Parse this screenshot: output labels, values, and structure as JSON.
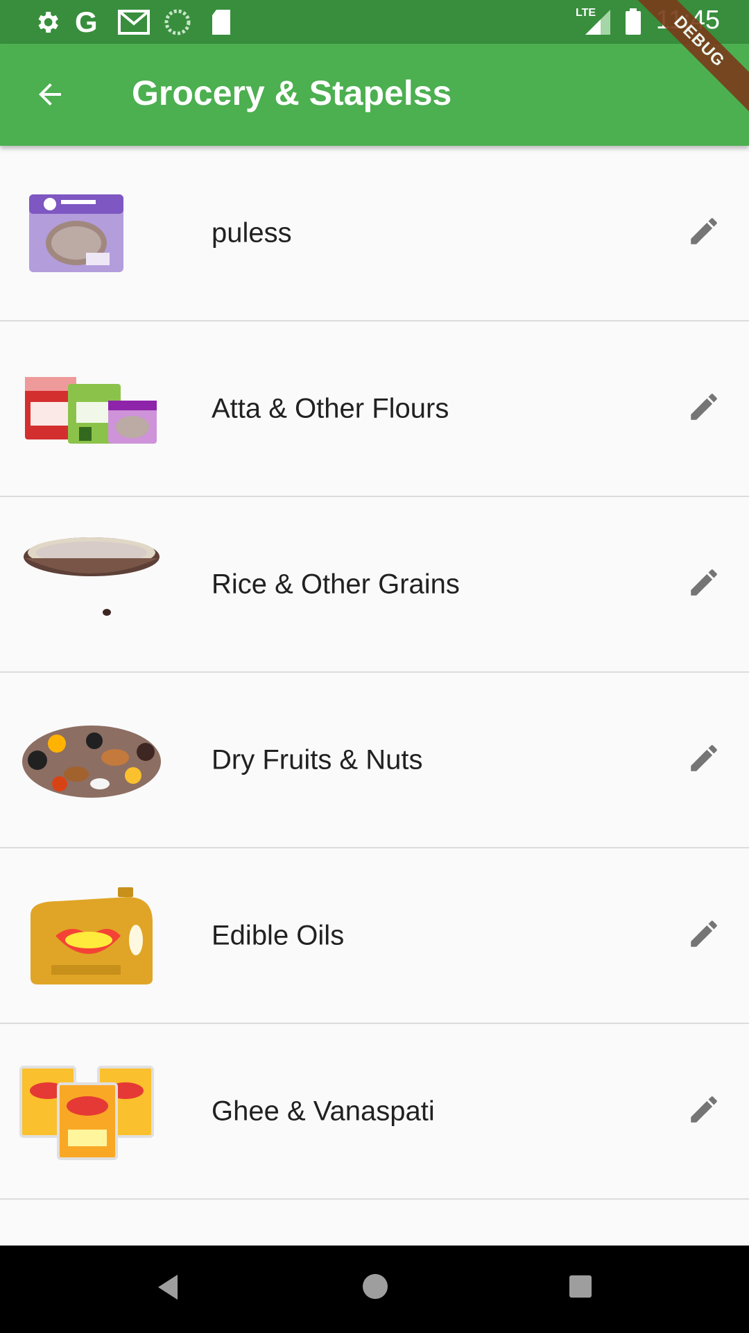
{
  "status_bar": {
    "time": "11:45",
    "network": "LTE",
    "icons": [
      "gear-icon",
      "google-icon",
      "gmail-icon",
      "sync-icon",
      "sd-card-icon",
      "signal-icon",
      "battery-icon"
    ]
  },
  "debug_banner": "DEBUG",
  "app_bar": {
    "title": "Grocery & Stapelss",
    "back_icon": "arrow-back-icon",
    "background": "#4caf50",
    "status_background": "#388e3c"
  },
  "categories": [
    {
      "label": "puless",
      "image": "pulses-pack-image"
    },
    {
      "label": "Atta & Other Flours",
      "image": "flour-packs-image"
    },
    {
      "label": "Rice & Other Grains",
      "image": "grain-bowl-image"
    },
    {
      "label": "Dry Fruits & Nuts",
      "image": "dry-fruits-image"
    },
    {
      "label": "Edible Oils",
      "image": "oil-can-image"
    },
    {
      "label": "Ghee & Vanaspati",
      "image": "ghee-packs-image"
    }
  ],
  "edit_icon": "pencil-icon",
  "nav_bar": {
    "back": "nav-back-icon",
    "home": "nav-home-icon",
    "recents": "nav-recents-icon"
  }
}
